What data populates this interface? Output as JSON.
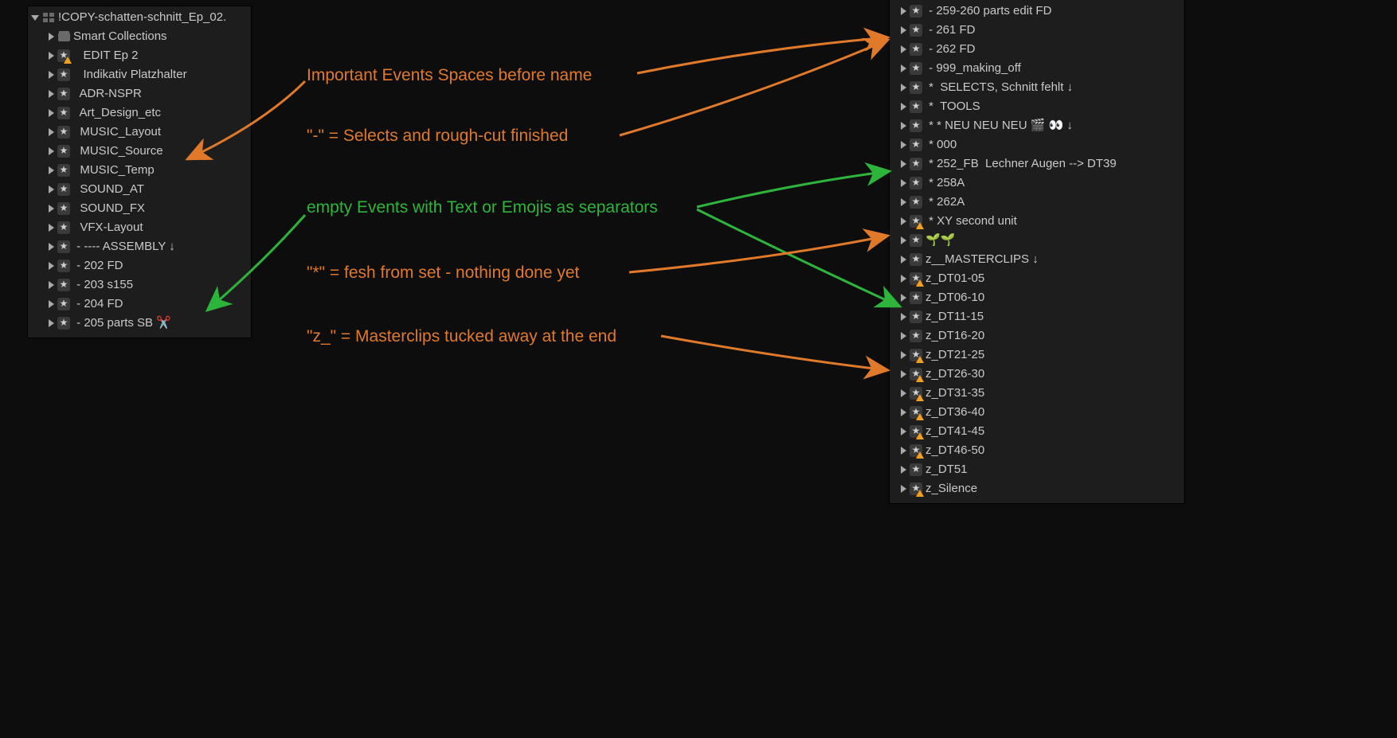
{
  "left_panel": {
    "library": "!COPY-schatten-schnitt_Ep_02.",
    "rows": [
      {
        "icon": "folder",
        "indent": 18,
        "label": "Smart Collections"
      },
      {
        "icon": "star-warn",
        "indent": 18,
        "label": "   EDIT Ep 2"
      },
      {
        "icon": "star",
        "indent": 18,
        "label": "   Indikativ Platzhalter"
      },
      {
        "icon": "star",
        "indent": 18,
        "label": "  ADR-NSPR"
      },
      {
        "icon": "star",
        "indent": 18,
        "label": "  Art_Design_etc"
      },
      {
        "icon": "star",
        "indent": 18,
        "label": "  MUSIC_Layout"
      },
      {
        "icon": "star",
        "indent": 18,
        "label": "  MUSIC_Source"
      },
      {
        "icon": "star",
        "indent": 18,
        "label": "  MUSIC_Temp"
      },
      {
        "icon": "star",
        "indent": 18,
        "label": "  SOUND_AT"
      },
      {
        "icon": "star",
        "indent": 18,
        "label": "  SOUND_FX"
      },
      {
        "icon": "star",
        "indent": 18,
        "label": "  VFX-Layout"
      },
      {
        "icon": "star",
        "indent": 18,
        "label": " - ---- ASSEMBLY ↓"
      },
      {
        "icon": "star",
        "indent": 18,
        "label": " - 202 FD"
      },
      {
        "icon": "star",
        "indent": 18,
        "label": " - 203 s155"
      },
      {
        "icon": "star",
        "indent": 18,
        "label": " - 204 FD"
      },
      {
        "icon": "star",
        "indent": 18,
        "label": " - 205 parts SB ✂️"
      }
    ]
  },
  "right_panel": {
    "rows": [
      {
        "icon": "star",
        "label": " - 259-260 parts edit FD"
      },
      {
        "icon": "star",
        "label": " - 261 FD"
      },
      {
        "icon": "star",
        "label": " - 262 FD"
      },
      {
        "icon": "star",
        "label": " - 999_making_off"
      },
      {
        "icon": "star",
        "label": " *  SELECTS, Schnitt fehlt ↓"
      },
      {
        "icon": "star",
        "label": " *  TOOLS"
      },
      {
        "icon": "star",
        "label": " * * NEU NEU NEU 🎬 👀 ↓"
      },
      {
        "icon": "star",
        "label": " * 000"
      },
      {
        "icon": "star",
        "label": " * 252_FB  Lechner Augen --> DT39"
      },
      {
        "icon": "star",
        "label": " * 258A"
      },
      {
        "icon": "star",
        "label": " * 262A"
      },
      {
        "icon": "star-warn",
        "label": " * XY second unit"
      },
      {
        "icon": "star",
        "label": "🌱🌱"
      },
      {
        "icon": "star",
        "label": "z__MASTERCLIPS ↓"
      },
      {
        "icon": "star-warn",
        "label": "z_DT01-05"
      },
      {
        "icon": "star",
        "label": "z_DT06-10"
      },
      {
        "icon": "star",
        "label": "z_DT11-15"
      },
      {
        "icon": "star",
        "label": "z_DT16-20"
      },
      {
        "icon": "star-warn",
        "label": "z_DT21-25"
      },
      {
        "icon": "star-warn",
        "label": "z_DT26-30"
      },
      {
        "icon": "star-warn",
        "label": "z_DT31-35"
      },
      {
        "icon": "star-warn",
        "label": "z_DT36-40"
      },
      {
        "icon": "star-warn",
        "label": "z_DT41-45"
      },
      {
        "icon": "star-warn",
        "label": "z_DT46-50"
      },
      {
        "icon": "star",
        "label": "z_DT51"
      },
      {
        "icon": "star-warn",
        "label": "z_Silence"
      }
    ]
  },
  "annotations": {
    "a1": "Important Events Spaces before name",
    "a2": "\"-\" = Selects and rough-cut finished",
    "a3": "empty Events with Text or Emojis as separators",
    "a4": "\"*\" = fesh from set - nothing done yet",
    "a5": "\"z_\" = Masterclips tucked away at the end"
  }
}
